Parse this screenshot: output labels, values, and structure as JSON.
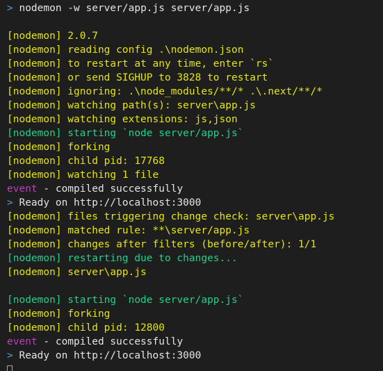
{
  "terminal": {
    "background_color": "#1e1e1e",
    "default_text_color": "#cccccc",
    "palette": {
      "yellow": "#e5e510",
      "green": "#23d18b",
      "magenta": "#bc3fbc",
      "white": "#e5e5e5",
      "prompt_blue": "#569cd6"
    },
    "cursor": {
      "style": "hollow-block",
      "color": "#a8a8a8"
    },
    "lines": [
      {
        "id": "l0",
        "type": "command",
        "segments": [
          {
            "text": "> ",
            "color": "prompt_blue"
          },
          {
            "text": "nodemon -w server/app.js server/app.js",
            "color": "white"
          }
        ]
      },
      {
        "id": "l1",
        "type": "blank",
        "segments": []
      },
      {
        "id": "l2",
        "type": "log",
        "segments": [
          {
            "text": "[nodemon] 2.0.7",
            "color": "yellow"
          }
        ]
      },
      {
        "id": "l3",
        "type": "log",
        "segments": [
          {
            "text": "[nodemon] reading config .\\nodemon.json",
            "color": "yellow"
          }
        ]
      },
      {
        "id": "l4",
        "type": "log",
        "segments": [
          {
            "text": "[nodemon] to restart at any time, enter `rs`",
            "color": "yellow"
          }
        ]
      },
      {
        "id": "l5",
        "type": "log",
        "segments": [
          {
            "text": "[nodemon] or send SIGHUP to 3828 to restart",
            "color": "yellow"
          }
        ]
      },
      {
        "id": "l6",
        "type": "log",
        "segments": [
          {
            "text": "[nodemon] ignoring: .\\node_modules/**/* .\\.next/**/*",
            "color": "yellow"
          }
        ]
      },
      {
        "id": "l7",
        "type": "log",
        "segments": [
          {
            "text": "[nodemon] watching path(s): server\\app.js",
            "color": "yellow"
          }
        ]
      },
      {
        "id": "l8",
        "type": "log",
        "segments": [
          {
            "text": "[nodemon] watching extensions: js,json",
            "color": "yellow"
          }
        ]
      },
      {
        "id": "l9",
        "type": "log",
        "segments": [
          {
            "text": "[nodemon] starting `node server/app.js`",
            "color": "green"
          }
        ]
      },
      {
        "id": "l10",
        "type": "log",
        "segments": [
          {
            "text": "[nodemon] forking",
            "color": "yellow"
          }
        ]
      },
      {
        "id": "l11",
        "type": "log",
        "segments": [
          {
            "text": "[nodemon] child pid: 17768",
            "color": "yellow"
          }
        ]
      },
      {
        "id": "l12",
        "type": "log",
        "segments": [
          {
            "text": "[nodemon] watching 1 file",
            "color": "yellow"
          }
        ]
      },
      {
        "id": "l13",
        "type": "event",
        "segments": [
          {
            "text": "event",
            "color": "magenta"
          },
          {
            "text": " - compiled successfully",
            "color": "white"
          }
        ]
      },
      {
        "id": "l14",
        "type": "status",
        "segments": [
          {
            "text": "> ",
            "color": "prompt_blue"
          },
          {
            "text": "Ready on http://localhost:3000",
            "color": "white"
          }
        ]
      },
      {
        "id": "l15",
        "type": "log",
        "segments": [
          {
            "text": "[nodemon] files triggering change check: server\\app.js",
            "color": "yellow"
          }
        ]
      },
      {
        "id": "l16",
        "type": "log",
        "segments": [
          {
            "text": "[nodemon] matched rule: **\\server/app.js",
            "color": "yellow"
          }
        ]
      },
      {
        "id": "l17",
        "type": "log",
        "segments": [
          {
            "text": "[nodemon] changes after filters (before/after): 1/1",
            "color": "yellow"
          }
        ]
      },
      {
        "id": "l18",
        "type": "log",
        "segments": [
          {
            "text": "[nodemon] restarting due to changes...",
            "color": "green"
          }
        ]
      },
      {
        "id": "l19",
        "type": "log",
        "segments": [
          {
            "text": "[nodemon] server\\app.js",
            "color": "yellow"
          }
        ]
      },
      {
        "id": "l20",
        "type": "blank",
        "segments": []
      },
      {
        "id": "l21",
        "type": "log",
        "segments": [
          {
            "text": "[nodemon] starting `node server/app.js`",
            "color": "green"
          }
        ]
      },
      {
        "id": "l22",
        "type": "log",
        "segments": [
          {
            "text": "[nodemon] forking",
            "color": "yellow"
          }
        ]
      },
      {
        "id": "l23",
        "type": "log",
        "segments": [
          {
            "text": "[nodemon] child pid: 12800",
            "color": "yellow"
          }
        ]
      },
      {
        "id": "l24",
        "type": "event",
        "segments": [
          {
            "text": "event",
            "color": "magenta"
          },
          {
            "text": " - compiled successfully",
            "color": "white"
          }
        ]
      },
      {
        "id": "l25",
        "type": "status",
        "segments": [
          {
            "text": "> ",
            "color": "prompt_blue"
          },
          {
            "text": "Ready on http://localhost:3000",
            "color": "white"
          }
        ]
      },
      {
        "id": "l26",
        "type": "cursor",
        "segments": []
      }
    ]
  }
}
